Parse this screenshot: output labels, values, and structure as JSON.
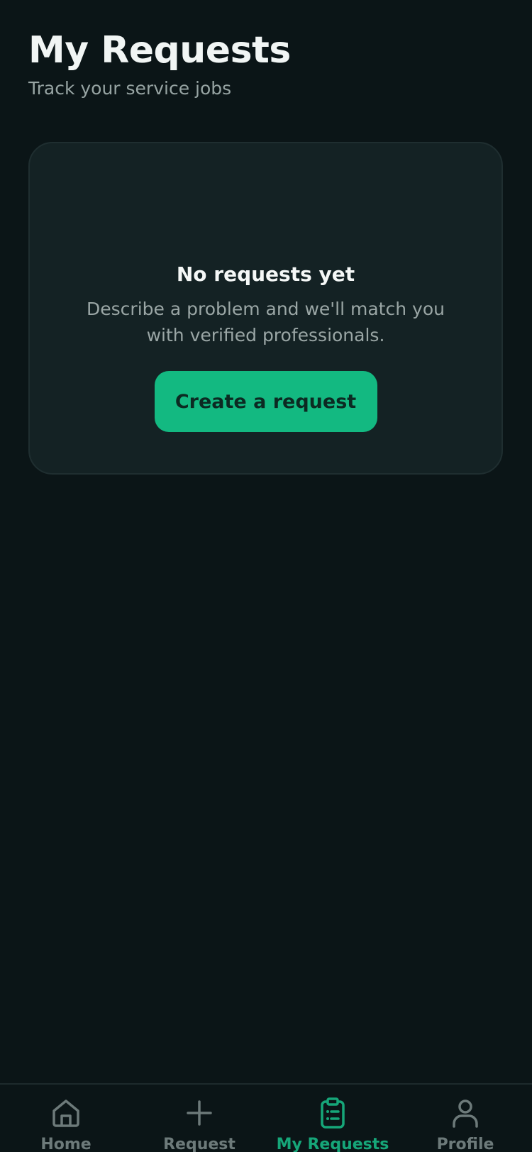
{
  "header": {
    "title": "My Requests",
    "subtitle": "Track your service jobs"
  },
  "empty_state": {
    "title": "No requests yet",
    "description": "Describe a problem and we'll match you with verified professionals.",
    "button_label": "Create a request"
  },
  "bottom_nav": {
    "items": [
      {
        "label": "Home",
        "icon": "home-icon",
        "active": false
      },
      {
        "label": "Request",
        "icon": "plus-icon",
        "active": false
      },
      {
        "label": "My Requests",
        "icon": "clipboard-list-icon",
        "active": true
      },
      {
        "label": "Profile",
        "icon": "user-icon",
        "active": false
      }
    ]
  },
  "colors": {
    "background": "#0b1517",
    "card": "#142224",
    "accent": "#13b981",
    "inactive": "#6d7a7a"
  }
}
